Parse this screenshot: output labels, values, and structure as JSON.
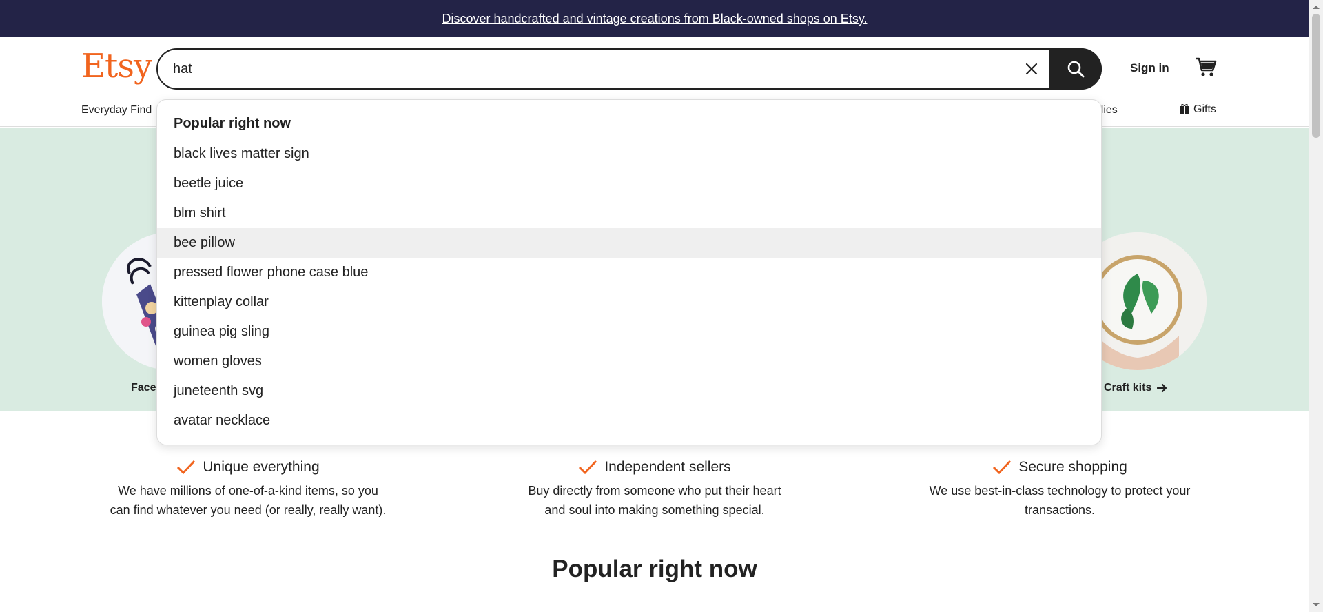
{
  "banner": {
    "text": "Discover handcrafted and vintage creations from Black-owned shops on Etsy."
  },
  "header": {
    "logo": "Etsy",
    "search": {
      "value": "hat",
      "placeholder": ""
    },
    "sign_in": "Sign in"
  },
  "nav": {
    "left_item": "Everyday Find",
    "right_item": "pplies",
    "gifts": "Gifts"
  },
  "dropdown": {
    "heading": "Popular right now",
    "items": [
      "black lives matter sign",
      "beetle juice",
      "blm shirt",
      "bee pillow",
      "pressed flower phone case blue",
      "kittenplay collar",
      "guinea pig sling",
      "women gloves",
      "juneteenth svg",
      "avatar necklace"
    ],
    "highlighted_index": 3
  },
  "hero": {
    "left_label": "Face",
    "right_label": "Craft kits"
  },
  "values": [
    {
      "title": "Unique everything",
      "text_line1": "We have millions of one-of-a-kind items, so you",
      "text_line2": "can find whatever you need (or really, really want)."
    },
    {
      "title": "Independent sellers",
      "text_line1": "Buy directly from someone who put their heart",
      "text_line2": "and soul into making something special."
    },
    {
      "title": "Secure shopping",
      "text_line1": "We use best-in-class technology to protect your",
      "text_line2": "transactions."
    }
  ],
  "popular_heading": "Popular right now",
  "colors": {
    "brand": "#f1641e",
    "banner": "#232347",
    "hero": "#d9ebe1",
    "check": "#f1641e"
  }
}
